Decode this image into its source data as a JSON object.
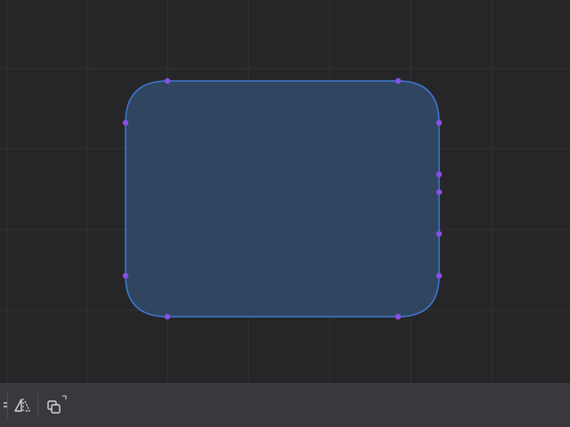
{
  "colors": {
    "canvas_background": "#262628",
    "grid_line": "#343437",
    "shape_fill": "#30455f",
    "shape_stroke": "#3d7ad6",
    "handle": "#8a4fe6",
    "toolbar_background": "#38383d",
    "toolbar_icon": "#d8d8dc"
  },
  "canvas": {
    "shape": "rounded-rectangle",
    "selected": true
  },
  "toolbar": {
    "tools": [
      {
        "name": "partially-visible-tool",
        "icon": "tool-icon"
      },
      {
        "name": "flip-tool",
        "icon": "flip-horizontal-icon"
      },
      {
        "name": "duplicate-tool",
        "icon": "duplicate-icon",
        "has_submenu": true
      }
    ]
  }
}
